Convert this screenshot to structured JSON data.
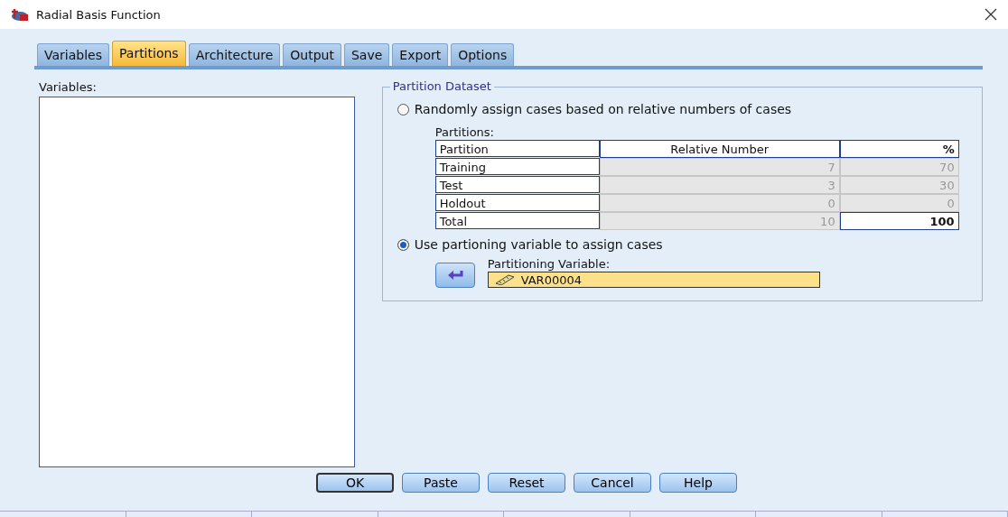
{
  "window": {
    "title": "Radial Basis Function"
  },
  "tabs": [
    {
      "label": "Variables",
      "selected": false
    },
    {
      "label": "Partitions",
      "selected": true
    },
    {
      "label": "Architecture",
      "selected": false
    },
    {
      "label": "Output",
      "selected": false
    },
    {
      "label": "Save",
      "selected": false
    },
    {
      "label": "Export",
      "selected": false
    },
    {
      "label": "Options",
      "selected": false
    }
  ],
  "variables_list": {
    "label": "Variables:"
  },
  "partition_dataset": {
    "title": "Partition Dataset",
    "options": [
      {
        "label": "Randomly assign cases based on relative numbers of cases",
        "selected": false
      },
      {
        "label": "Use partioning variable to assign cases",
        "selected": true
      }
    ],
    "table": {
      "label": "Partitions:",
      "columns": [
        "Partition",
        "Relative Number",
        "%"
      ],
      "rows": [
        {
          "cells": [
            "Training",
            "7",
            "70"
          ],
          "disabled": true,
          "total": false
        },
        {
          "cells": [
            "Test",
            "3",
            "30"
          ],
          "disabled": true,
          "total": false
        },
        {
          "cells": [
            "Holdout",
            "0",
            "0"
          ],
          "disabled": true,
          "total": false
        },
        {
          "cells": [
            "Total",
            "10",
            "100"
          ],
          "disabled": true,
          "total": true
        }
      ]
    },
    "partitioning_variable": {
      "label": "Partitioning Variable:",
      "value": "VAR00004"
    }
  },
  "buttons": [
    {
      "label": "OK",
      "default": true
    },
    {
      "label": "Paste",
      "default": false
    },
    {
      "label": "Reset",
      "default": false
    },
    {
      "label": "Cancel",
      "default": false
    },
    {
      "label": "Help",
      "default": false
    }
  ]
}
